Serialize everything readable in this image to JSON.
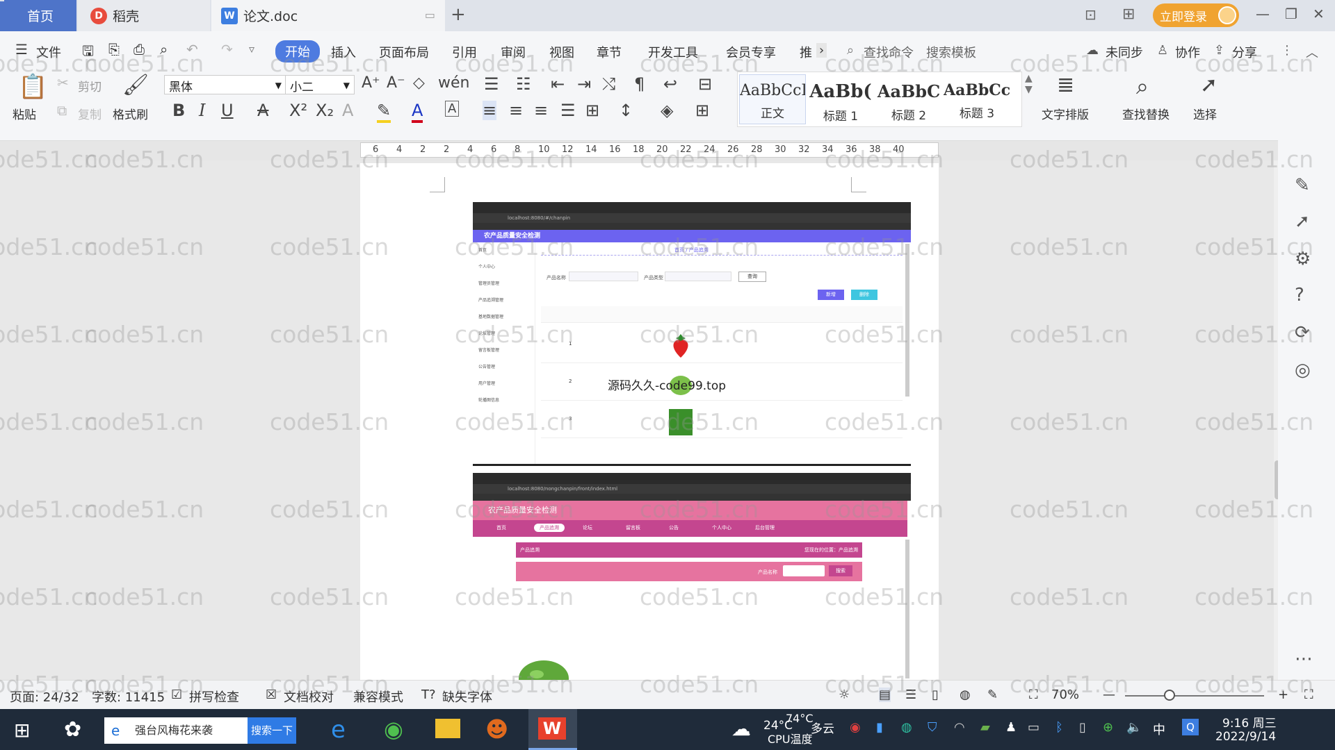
{
  "tabs": {
    "home": "首页",
    "daoke": "稻壳",
    "doc": "论文.doc"
  },
  "title_actions": {
    "login": "立即登录"
  },
  "menu": {
    "file": "文件",
    "items": [
      "开始",
      "插入",
      "页面布局",
      "引用",
      "审阅",
      "视图",
      "章节",
      "开发工具",
      "会员专享",
      "推"
    ],
    "search_command": "查找命令",
    "search_template": "搜索模板",
    "sync": "未同步",
    "collab": "协作",
    "share": "分享"
  },
  "ribbon": {
    "paste": "粘贴",
    "cut": "剪切",
    "copy": "复制",
    "format_painter": "格式刷",
    "font_name": "黑体",
    "font_size": "小二",
    "styles": [
      {
        "sample": "AaBbCcI",
        "name": "正文"
      },
      {
        "sample": "AaBb(",
        "name": "标题 1"
      },
      {
        "sample": "AaBbC",
        "name": "标题 2"
      },
      {
        "sample": "AaBbCcI",
        "name": "标题 3"
      }
    ],
    "text_layout": "文字排版",
    "find_replace": "查找替换",
    "select": "选择"
  },
  "ruler": {
    "ticks": [
      "6",
      "4",
      "2",
      "2",
      "4",
      "6",
      "8",
      "10",
      "12",
      "14",
      "16",
      "18",
      "20",
      "22",
      "24",
      "26",
      "28",
      "30",
      "32",
      "34",
      "36",
      "38",
      "40"
    ]
  },
  "document": {
    "overlay_text": "源码久久-code99.top",
    "screenshot1": {
      "url": "localhost:8080/#/chanpin",
      "app_title": "农产品质量安全检测",
      "sidebar": [
        "首页",
        "个人中心",
        "管理员管理",
        "产品追溯管理",
        "基地数据管理",
        "论坛管理",
        "留言板管理",
        "公告管理",
        "用户管理",
        "轮播图信息"
      ],
      "breadcrumb": "首页 / 产品追溯",
      "search_labels": [
        "产品名称",
        "产品类型"
      ],
      "search_btn": "查询",
      "btn_add": "新增",
      "btn_del": "删除",
      "rows": [
        "1",
        "2",
        "3"
      ]
    },
    "screenshot2": {
      "url": "localhost:8080/nongchanpin/front/index.html",
      "app_title": "农产品质量安全检测",
      "nav": [
        "首页",
        "产品追溯",
        "论坛",
        "留言板",
        "公告",
        "个人中心",
        "后台管理"
      ],
      "section": "产品追溯",
      "location": "您现在的位置：产品追溯",
      "search_label": "产品名称",
      "search_btn": "搜索"
    }
  },
  "status": {
    "page": "页面: 24/32",
    "words": "字数: 11415",
    "spell": "拼写检查",
    "proof": "文档校对",
    "compat": "兼容模式",
    "missing_font": "缺失字体",
    "zoom": "70%"
  },
  "taskbar": {
    "search_text": "强台风梅花来袭",
    "search_btn": "搜索一下",
    "weather_temp": "24°C",
    "weather_desc": "多云",
    "cpu_temp": "74°C",
    "cpu_label": "CPU温度",
    "ime": "中",
    "time": "9:16 周三",
    "date": "2022/9/14"
  },
  "watermark": "code51.cn",
  "colors": {
    "accent": "#4e7be0",
    "login": "#f0a330",
    "admin_purple": "#6c63f0",
    "front_pink": "#e6739f"
  }
}
